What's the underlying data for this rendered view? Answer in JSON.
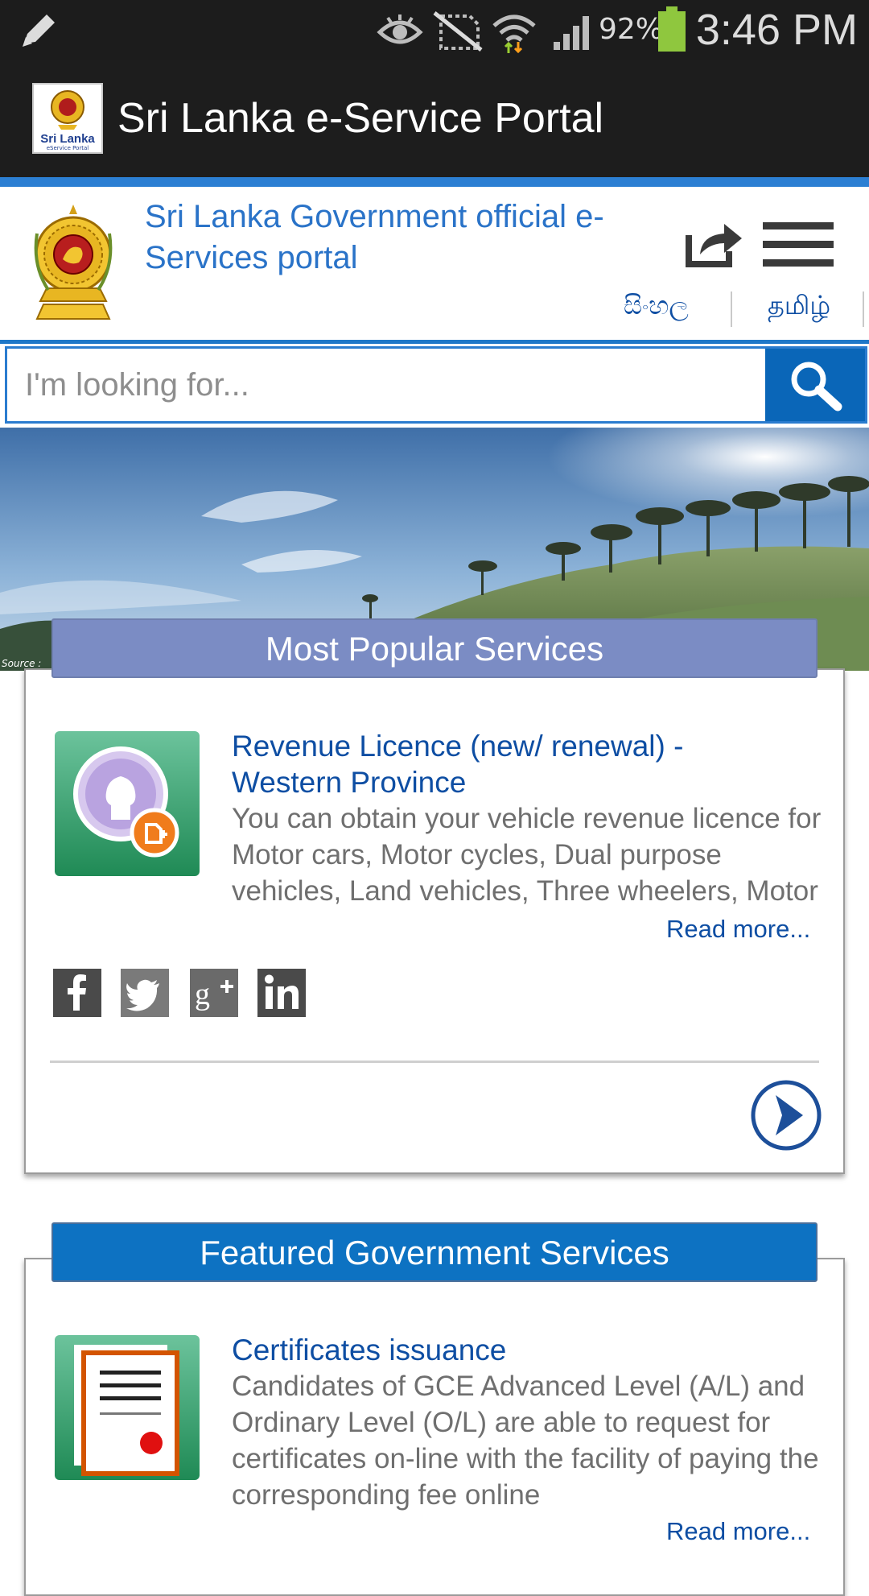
{
  "status_bar": {
    "battery": "92%",
    "time": "3:46 PM",
    "icons": [
      "pencil-icon",
      "eye-icon",
      "no-sim-icon",
      "wifi-icon",
      "signal-icon",
      "battery-icon"
    ]
  },
  "app_bar": {
    "title": "Sri Lanka e-Service Portal",
    "logo_text": "Sri Lanka",
    "logo_subtext": "eService Portal"
  },
  "header": {
    "title": "Sri Lanka Government official e-Services portal",
    "languages": [
      "සිංහල",
      "தமிழ்"
    ]
  },
  "search": {
    "placeholder": "I'm looking for..."
  },
  "hero": {
    "source_label": "Source :"
  },
  "popular": {
    "heading": "Most Popular Services",
    "title": "Revenue Licence (new/ renewal) - Western Province",
    "description": "You can obtain your vehicle revenue licence for Motor cars, Motor cycles, Dual purpose vehicles, Land vehicles, Three wheelers, Motor cars & Trailers and lorries",
    "read_more": "Read more...",
    "social": [
      "facebook-icon",
      "twitter-icon",
      "google-plus-icon",
      "linkedin-icon"
    ]
  },
  "featured": {
    "heading": "Featured Government Services",
    "title": "Certificates issuance",
    "description": "Candidates of GCE Advanced Level (A/L) and Ordinary Level (O/L) are able to request for certificates on-line with the facility of paying the corresponding fee online",
    "read_more": "Read more..."
  },
  "colors": {
    "accent": "#2a7ccf",
    "popular_header": "#7b8cc4",
    "featured_header": "#0d72c2",
    "link": "#0e4ea3"
  }
}
